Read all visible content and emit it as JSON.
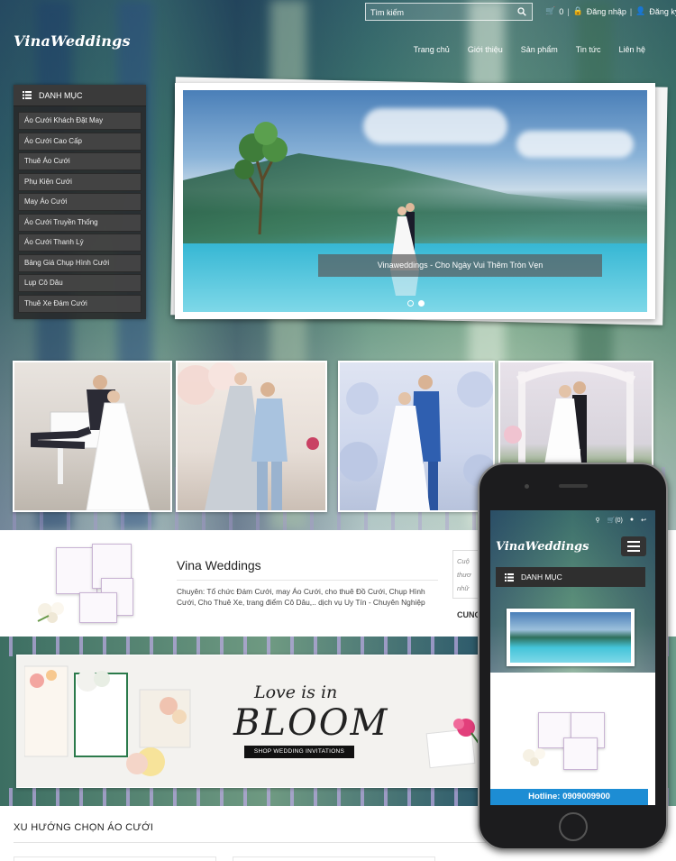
{
  "header": {
    "search_placeholder": "Tìm kiếm",
    "cart_label": "0",
    "login_label": "Đăng nhập",
    "register_label": "Đăng ký",
    "logo": "VinaWeddings",
    "nav": [
      "Trang chủ",
      "Giới thiệu",
      "Sản phẩm",
      "Tin tức",
      "Liên hệ"
    ]
  },
  "sidebar": {
    "title": "DANH MỤC",
    "items": [
      "Áo Cưới Khách Đặt May",
      "Áo Cưới Cao Cấp",
      "Thuê Áo Cưới",
      "Phụ Kiện Cưới",
      "May Áo Cưới",
      "Áo Cưới Truyền Thống",
      "Áo Cưới Thanh Lý",
      "Bảng Giá Chụp Hình Cưới",
      "Lụp Cô Dâu",
      "Thuê Xe Đám Cưới"
    ]
  },
  "slider": {
    "caption": "Vinaweddings - Cho Ngày Vui Thêm Tròn Vẹn",
    "slides": 2,
    "active_slide": 2
  },
  "about": {
    "title": "Vina Weddings",
    "text": "Chuyên: Tổ chức Đám Cưới, may Áo Cưới, cho thuê Đồ Cưới, Chụp Hình Cưới, Cho Thuê Xe, trang điểm Cô Dâu,.. dịch vụ Uy Tín - Chuyên Nghiệp",
    "quote_lines": [
      "Cuộ",
      "thươ",
      "nhữ"
    ],
    "side_heading": "CUNG"
  },
  "banner": {
    "line1": "Love is in",
    "line2": "BLOOM",
    "button": "SHOP WEDDING INVITATIONS"
  },
  "section": {
    "trend_title": "XU HƯỚNG CHỌN ÁO CƯỚI"
  },
  "mobile": {
    "logo": "VinaWeddings",
    "cart_label": "(0)",
    "category_title": "DANH MỤC",
    "hotline": "Hotline: 0909009900"
  },
  "colors": {
    "hotline_bg": "#1d8dd4",
    "menu_bg": "#333333"
  }
}
